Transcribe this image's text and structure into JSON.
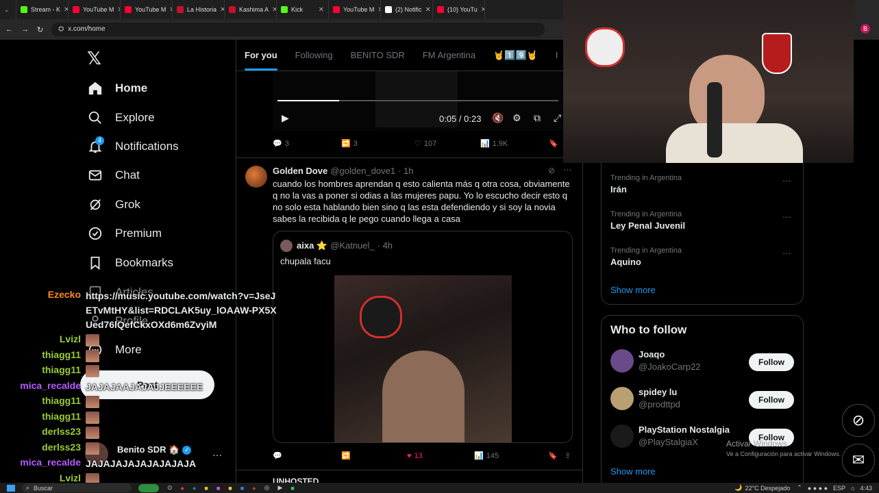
{
  "browser": {
    "tabs": [
      {
        "label": "Stream - K",
        "color": "#53fc18"
      },
      {
        "label": "YouTube M",
        "color": "#ff0033"
      },
      {
        "label": "YouTube M",
        "color": "#ff0033"
      },
      {
        "label": "La Historia",
        "color": "#c8102e"
      },
      {
        "label": "Kashima A",
        "color": "#c8102e"
      },
      {
        "label": "Kick",
        "color": "#53fc18"
      },
      {
        "label": "YouTube M",
        "color": "#ff0033"
      },
      {
        "label": "(2) Notific",
        "color": "#ffffff"
      },
      {
        "label": "(10) YouTu",
        "color": "#ff0033"
      }
    ],
    "url": "x.com/home",
    "profile_initial": "B"
  },
  "nav": {
    "home": "Home",
    "explore": "Explore",
    "notifications": "Notifications",
    "notifications_badge": "4",
    "chat": "Chat",
    "grok": "Grok",
    "premium": "Premium",
    "bookmarks": "Bookmarks",
    "articles": "Articles",
    "profile": "Profile",
    "more": "More",
    "post": "Post"
  },
  "account": {
    "name": "Benito SDR 🏠",
    "menu": "···"
  },
  "feed_tabs": [
    "For you",
    "Following",
    "BENITO SDR",
    "FM Argentina",
    "🤘1️⃣9️⃣🤘",
    "I"
  ],
  "video_post": {
    "time": "0:05 / 0:23",
    "progress": 0.22,
    "replies": "3",
    "reposts": "3",
    "likes": "107",
    "views": "1.9K"
  },
  "post": {
    "author": "Golden Dove",
    "handle": "@golden_dove1",
    "time": "· 1h",
    "text": "cuando los hombres aprendan q esto calienta más q otra cosa, obviamente q no la vas a poner si odias a las mujeres papu. Yo lo escucho decir esto q no solo esta hablando bien sino q las esta defendiendo y si soy la novia sabes la recibida q le pego cuando llega a casa",
    "quote_author": "aixa ⭐",
    "quote_handle": "@Katnuel_",
    "quote_time": "· 4h",
    "quote_text": "chupala facu",
    "likes": "13",
    "views": "145"
  },
  "next_post_author": "UNHOSTED",
  "trends": [
    {
      "category": "Trending in Argentina",
      "name": "Irán"
    },
    {
      "category": "Trending in Argentina",
      "name": "Ley Penal Juvenil"
    },
    {
      "category": "Trending in Argentina",
      "name": "Aquino"
    }
  ],
  "show_more": "Show more",
  "who_to_follow": {
    "title": "Who to follow",
    "accounts": [
      {
        "name": "Joaqo",
        "handle": "@JoakoCarp22",
        "button": "Follow"
      },
      {
        "name": "spidey lu",
        "handle": "@prodttpd",
        "button": "Follow"
      },
      {
        "name": "PlayStation Nostalgia",
        "handle": "@PlayStalgiaX",
        "button": "Follow"
      }
    ],
    "show_more": "Show more"
  },
  "windows_activation": {
    "title": "Activar Windows",
    "subtitle": "Ve a Configuración para activar Windows."
  },
  "chat": [
    {
      "user": "Ezecko",
      "color": "#ff8c1a",
      "message": "https://music.youtube.com/watch?v=JseJETvMtHY&list=RDCLAK5uy_lOAAW-PX5XUed76lQefCkxOXd6m6ZvyiM"
    },
    {
      "user": "Lvizl",
      "color": "#9acd32",
      "message": ""
    },
    {
      "user": "thiagg11",
      "color": "#9acd32",
      "message": ""
    },
    {
      "user": "thiagg11",
      "color": "#9acd32",
      "message": ""
    },
    {
      "user": "mica_recalde",
      "color": "#b45cff",
      "message": "JAJAJAAJAJAJJEEEEEE"
    },
    {
      "user": "thiagg11",
      "color": "#9acd32",
      "message": ""
    },
    {
      "user": "thiagg11",
      "color": "#9acd32",
      "message": ""
    },
    {
      "user": "derlss23",
      "color": "#9acd32",
      "message": ""
    },
    {
      "user": "derlss23",
      "color": "#9acd32",
      "message": ""
    },
    {
      "user": "mica_recalde",
      "color": "#b45cff",
      "message": "JAJAJAJAJAJAJAJAJA"
    },
    {
      "user": "Lvizl",
      "color": "#9acd32",
      "message": ""
    }
  ],
  "taskbar": {
    "search": "Buscar",
    "weather": "22°C  Despejado",
    "lang": "ESP",
    "time": "4:43"
  }
}
